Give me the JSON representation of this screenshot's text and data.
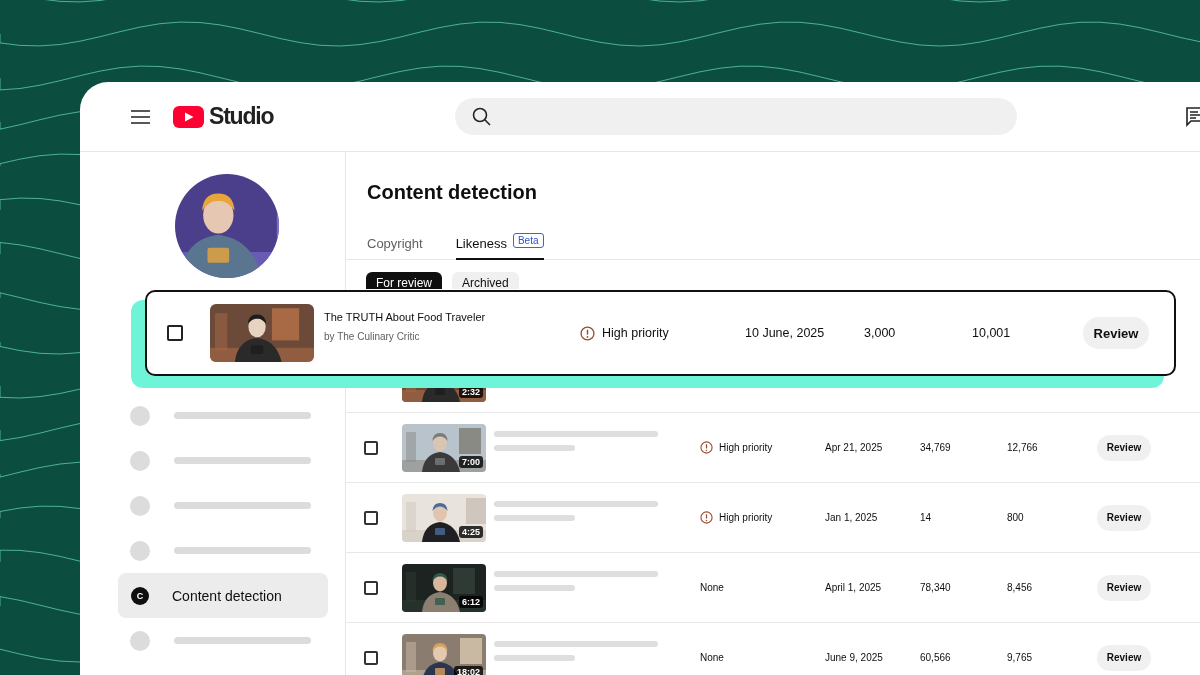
{
  "header": {
    "logo_text": "Studio"
  },
  "sidebar": {
    "items": [
      {
        "kind": "placeholder",
        "selected": false
      },
      {
        "kind": "placeholder",
        "selected": false
      },
      {
        "kind": "placeholder",
        "selected": false
      },
      {
        "kind": "placeholder",
        "selected": false
      },
      {
        "kind": "link",
        "icon_letter": "C",
        "label": "Content detection",
        "selected": true
      },
      {
        "kind": "placeholder",
        "selected": false
      }
    ]
  },
  "page": {
    "title": "Content detection",
    "tabs": [
      {
        "label": "Copyright",
        "selected": false
      },
      {
        "label": "Likeness",
        "badge": "Beta",
        "selected": true
      }
    ],
    "filters": [
      {
        "label": "For review",
        "selected": true
      },
      {
        "label": "Archived",
        "selected": false
      }
    ]
  },
  "highlighted_row": {
    "checked": false,
    "title": "The TRUTH About Food Traveler",
    "channel": "by The Culinary Critic",
    "flagged": true,
    "priority": "High priority",
    "date": "10 June, 2025",
    "column_5": "3,000",
    "column_6": "10,001",
    "action": "Review"
  },
  "rows": [
    {
      "duration": "2:32"
    },
    {
      "checked": false,
      "duration": "7:00",
      "flagged": true,
      "priority": "High priority",
      "date": "Apr 21, 2025",
      "column_5": "34,769",
      "column_6": "12,766",
      "action": "Review"
    },
    {
      "checked": false,
      "duration": "4:25",
      "flagged": true,
      "priority": "High priority",
      "date": "Jan 1, 2025",
      "column_5": "14",
      "column_6": "800",
      "action": "Review"
    },
    {
      "checked": false,
      "duration": "6:12",
      "flagged": false,
      "priority": "None",
      "date": "April 1, 2025",
      "column_5": "78,340",
      "column_6": "8,456",
      "action": "Review"
    },
    {
      "checked": false,
      "duration": "18:02",
      "flagged": false,
      "priority": "None",
      "date": "June 9, 2025",
      "column_5": "60,566",
      "column_6": "9,765",
      "action": "Review"
    }
  ]
}
